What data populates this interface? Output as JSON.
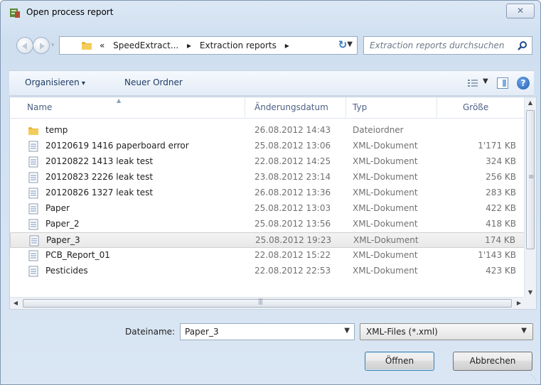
{
  "window": {
    "title": "Open process report",
    "close_glyph": "✕"
  },
  "address": {
    "prefix": "«",
    "crumbs": [
      "SpeedExtract...",
      "▸",
      "Extraction reports",
      "▸"
    ],
    "search_placeholder": "Extraction reports durchsuchen"
  },
  "toolbar": {
    "organize_label": "Organisieren",
    "new_folder_label": "Neuer Ordner"
  },
  "columns": {
    "name": "Name",
    "date": "Änderungsdatum",
    "type": "Typ",
    "size": "Größe"
  },
  "files": [
    {
      "name": "temp",
      "date": "26.08.2012 14:43",
      "type": "Dateiordner",
      "size": "",
      "kind": "folder"
    },
    {
      "name": "20120619 1416 paperboard error",
      "date": "25.08.2012 13:06",
      "type": "XML-Dokument",
      "size": "1'171 KB",
      "kind": "file"
    },
    {
      "name": "20120822 1413 leak test",
      "date": "22.08.2012 14:25",
      "type": "XML-Dokument",
      "size": "324 KB",
      "kind": "file"
    },
    {
      "name": "20120823 2226 leak test",
      "date": "23.08.2012 23:14",
      "type": "XML-Dokument",
      "size": "256 KB",
      "kind": "file"
    },
    {
      "name": "20120826 1327 leak test",
      "date": "26.08.2012 13:36",
      "type": "XML-Dokument",
      "size": "283 KB",
      "kind": "file"
    },
    {
      "name": "Paper",
      "date": "25.08.2012 13:03",
      "type": "XML-Dokument",
      "size": "422 KB",
      "kind": "file"
    },
    {
      "name": "Paper_2",
      "date": "25.08.2012 13:56",
      "type": "XML-Dokument",
      "size": "418 KB",
      "kind": "file"
    },
    {
      "name": "Paper_3",
      "date": "25.08.2012 19:23",
      "type": "XML-Dokument",
      "size": "174 KB",
      "kind": "file",
      "selected": true
    },
    {
      "name": "PCB_Report_01",
      "date": "22.08.2012 15:22",
      "type": "XML-Dokument",
      "size": "1'143 KB",
      "kind": "file"
    },
    {
      "name": "Pesticides",
      "date": "22.08.2012 22:53",
      "type": "XML-Dokument",
      "size": "423 KB",
      "kind": "file"
    }
  ],
  "footer": {
    "filename_label": "Dateiname:",
    "filename_value": "Paper_3",
    "filter_value": "XML-Files (*.xml)",
    "open_label": "Öffnen",
    "cancel_label": "Abbrechen"
  },
  "colors": {
    "accent": "#3a78c4",
    "selected_row": "#e8e8e8",
    "folder": "#e8b73c"
  }
}
